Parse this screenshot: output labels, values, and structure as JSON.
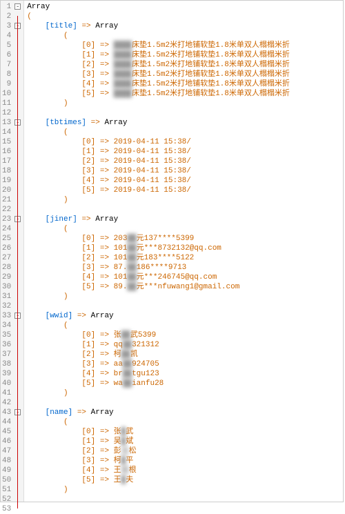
{
  "array_label": "Array",
  "open_paren": "(",
  "close_paren": ")",
  "arrow": "=>",
  "sections": [
    {
      "key": "title",
      "items": [
        {
          "blur": "████",
          "after": "床垫1.5m2米打地铺软垫1.8米单双人榻榻米折"
        },
        {
          "blur": "████",
          "after": "床垫1.5m2米打地铺软垫1.8米单双人榻榻米折"
        },
        {
          "blur": "████",
          "after": "床垫1.5m2米打地铺软垫1.8米单双人榻榻米折"
        },
        {
          "blur": "████",
          "after": "床垫1.5m2米打地铺软垫1.8米单双人榻榻米折"
        },
        {
          "blur": "████",
          "after": "床垫1.5m2米打地铺软垫1.8米单双人榻榻米折"
        },
        {
          "blur": "████",
          "after": "床垫1.5m2米打地铺软垫1.8米单双人榻榻米折"
        }
      ]
    },
    {
      "key": "tbtimes",
      "items": [
        {
          "text": "2019-04-11 15:38/"
        },
        {
          "text": "2019-04-11 15:38/"
        },
        {
          "text": "2019-04-11 15:38/"
        },
        {
          "text": "2019-04-11 15:38/"
        },
        {
          "text": "2019-04-11 15:38/"
        },
        {
          "text": "2019-04-11 15:38/"
        }
      ]
    },
    {
      "key": "jiner",
      "items": [
        {
          "pre": "203",
          "blur": "██",
          "mid": "元137****5399"
        },
        {
          "pre": "101",
          "blur": "██",
          "mid": "元***8732132@qq.com"
        },
        {
          "pre": "101",
          "blur": "██",
          "mid": "元183****5122"
        },
        {
          "pre": "87.",
          "blur": "██",
          "mid": "186****9713"
        },
        {
          "pre": "101",
          "blur": "██",
          "mid": "元***246745@qq.com"
        },
        {
          "pre": "89.",
          "blur": "██",
          "mid": "元***nfuwang1@gmail.com"
        }
      ]
    },
    {
      "key": "wwid",
      "items": [
        {
          "pre": "张",
          "blur": "██",
          "mid": "武5399"
        },
        {
          "pre": "qq",
          "blur": "██",
          "mid": "321312"
        },
        {
          "pre": "柯",
          "blur": "██",
          "mid": "凯"
        },
        {
          "pre": "aa",
          "blur": "██",
          "mid": "924705"
        },
        {
          "pre": "br",
          "blur": "██",
          "mid": "tgu123"
        },
        {
          "pre": "wa",
          "blur": "██",
          "mid": "ianfu28"
        }
      ]
    },
    {
      "key": "name",
      "items": [
        {
          "pre": "张",
          "blur": "█",
          "mid": "武"
        },
        {
          "pre": "吴",
          "blur": "█",
          "mid": "斌"
        },
        {
          "pre": "彭",
          "blur": "文",
          "mid": "松"
        },
        {
          "pre": "柯",
          "blur": "█",
          "mid": "平"
        },
        {
          "pre": "王",
          "blur": "厨",
          "mid": "根"
        },
        {
          "pre": "王",
          "blur": "█",
          "mid": "夫"
        }
      ]
    }
  ]
}
